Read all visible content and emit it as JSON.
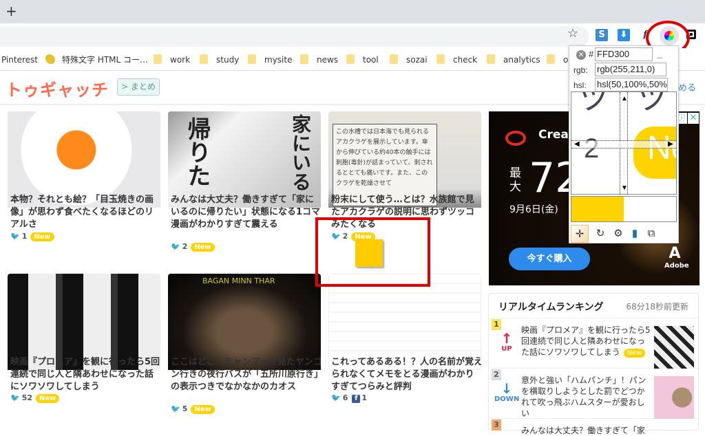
{
  "browser": {
    "new_tab_label": "+",
    "bookmark_star": "☆",
    "extensions": [
      {
        "name": "s-extension",
        "glyph": "S"
      },
      {
        "name": "download-extension",
        "glyph": "⬇"
      },
      {
        "name": "function-extension",
        "glyph": "f"
      },
      {
        "name": "color-picker-extension",
        "glyph": ""
      },
      {
        "name": "square-extension",
        "glyph": ""
      }
    ],
    "bookmarks": [
      {
        "label": "Pinterest",
        "icon": "none"
      },
      {
        "label": "特殊文字 HTML コー…",
        "icon": "pikachu-icon"
      },
      {
        "label": "work",
        "icon": "folder-icon"
      },
      {
        "label": "study",
        "icon": "folder-icon"
      },
      {
        "label": "mysite",
        "icon": "folder-icon"
      },
      {
        "label": "news",
        "icon": "folder-icon"
      },
      {
        "label": "tool",
        "icon": "folder-icon"
      },
      {
        "label": "sozai",
        "icon": "folder-icon"
      },
      {
        "label": "check",
        "icon": "folder-icon"
      },
      {
        "label": "analytics",
        "icon": "folder-icon"
      },
      {
        "label": "o",
        "icon": "folder-icon"
      }
    ]
  },
  "site": {
    "logo": "トゥギャッチ",
    "matome_button": "> まとめ",
    "header_right_partial": "める",
    "articles": [
      {
        "title": "本物？それとも絵？「目玉焼きの画像」が思わず食べたくなるほどのリアルさ",
        "tweets": "1",
        "facebook": null,
        "new": "New"
      },
      {
        "title": "みんなは大丈夫？働きすぎて「家にいるのに帰りたい」状態になる1コマ漫画がわかりすぎて震える",
        "tweets": "2",
        "facebook": null,
        "new": "New",
        "thumb_text_left": "帰りた",
        "thumb_text_right": "家にいる"
      },
      {
        "title": "粉末にして使う…とは？水族館で見たアカクラゲの説明に思わずツッコみたくなる",
        "tweets": "2",
        "facebook": null,
        "new": "New",
        "thumb_text": "この水槽では日本海でも見られるアカクラゲを展示しています。傘から伸びている約40本の触手には刺胞(毒針)が詰まっていて、刺されるととても痛いです。また、このクラゲを乾燥させて"
      },
      {
        "title": "映画『プロメア』を観に行ったら5回連続で同じ人と隣あわせになった話にソワソワしてしまう",
        "tweets": "52",
        "facebook": null,
        "new": "New"
      },
      {
        "title": "ここはどこ？ミャンマーで見たヤンゴン行きの夜行バスが「五所川原行き」の表示つきでなかなかのカオス",
        "tweets": "5",
        "facebook": null,
        "new": "New",
        "thumb_text": "BAGAN MINN THAR"
      },
      {
        "title": "これってあるある！？人の名前が覚えられなくてメモをとる漫画がわかりすぎてつらみと評判",
        "tweets": "6",
        "facebook": "1",
        "new": null
      }
    ],
    "ad": {
      "brand": "Creati",
      "max_label": "最大",
      "big_number": "72",
      "date": "9月6日(金)",
      "cta": "今すぐ購入",
      "adobe": "Adobe",
      "info_glyph": "ⓘ",
      "close_glyph": "✕"
    },
    "ranking": {
      "title": "リアルタイムランキング",
      "updated": "68分18秒前更新",
      "items": [
        {
          "rank": "1",
          "trend": "UP",
          "trend_arrow": "↑",
          "title": "映画『プロメア』を観に行ったら5回連続で同じ人と隣あわせになった話にソワソワしてしまう",
          "new": "New"
        },
        {
          "rank": "2",
          "trend": "DOWN",
          "trend_arrow": "↓",
          "title": "意外と強い「ハムパンチ」！パンを横取りしようとした罰でどつかれて吹っ飛ぶハムスターが愛おしい",
          "new": null
        },
        {
          "rank": "3",
          "trend": "",
          "trend_arrow": "",
          "title": "みんなは大丈夫？働きすぎて「家",
          "new": null
        }
      ]
    }
  },
  "color_picker": {
    "hex_prefix": "#",
    "hex": "FFD300",
    "rgb_label": "rgb:",
    "rgb": "rgb(255,211,0)",
    "hsl_label": "hsl:",
    "hsl": "hsl(50,100%,50%",
    "underscore": "_",
    "close_glyph": "✕",
    "selected_color": "#FFD300",
    "magnifier_text": {
      "tsu": "ツ",
      "two": "2",
      "new": "Ne"
    },
    "buttons": [
      {
        "name": "crosshair-button",
        "glyph": "✛"
      },
      {
        "name": "refresh-button",
        "glyph": "↻"
      },
      {
        "name": "settings-button",
        "glyph": "⚙"
      },
      {
        "name": "mobile-button",
        "glyph": "▮"
      },
      {
        "name": "popout-button",
        "glyph": "⧉"
      }
    ]
  },
  "annotations": {
    "highlight_color": "#E00000",
    "swatch_color": "#FFCC00"
  }
}
